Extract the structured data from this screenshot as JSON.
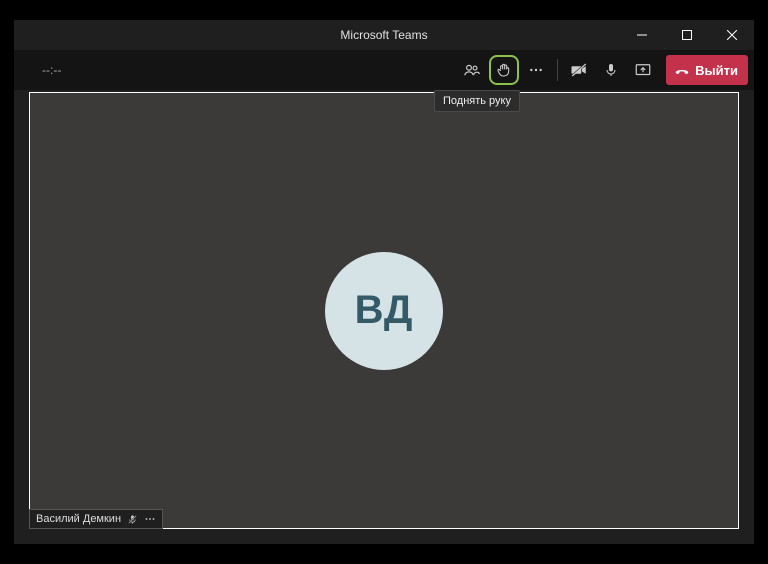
{
  "titlebar": {
    "title": "Microsoft Teams"
  },
  "toolbar": {
    "timer": "--:--",
    "leave_label": "Выйти"
  },
  "tooltip": {
    "raise_hand": "Поднять руку"
  },
  "participant": {
    "initials": "ВД",
    "name": "Василий Демкин"
  }
}
